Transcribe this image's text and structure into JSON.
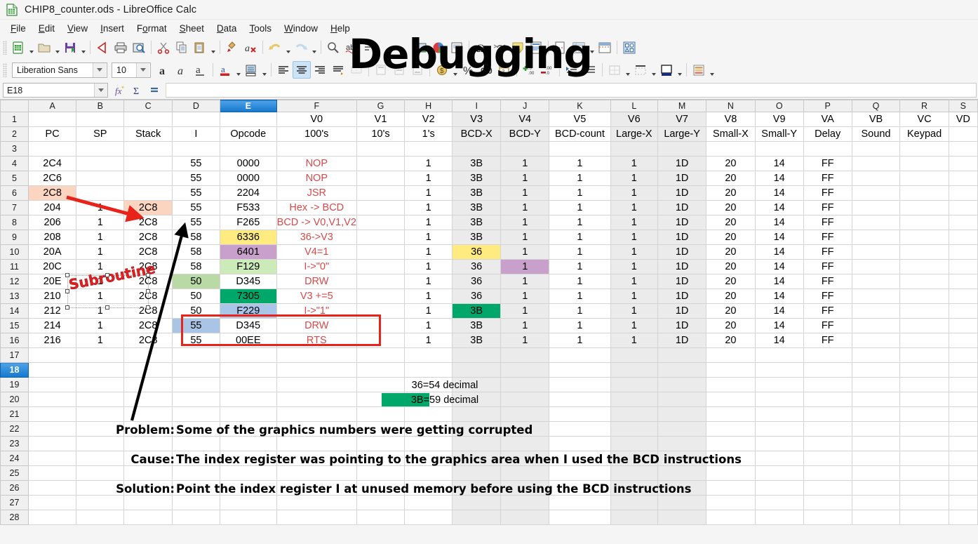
{
  "window": {
    "title": "CHIP8_counter.ods - LibreOffice Calc",
    "app_icon": "calc-document-icon"
  },
  "menubar": {
    "items": [
      {
        "label": "File",
        "accel": "F"
      },
      {
        "label": "Edit",
        "accel": "E"
      },
      {
        "label": "View",
        "accel": "V"
      },
      {
        "label": "Insert",
        "accel": "I"
      },
      {
        "label": "Format",
        "accel": "o"
      },
      {
        "label": "Sheet",
        "accel": "S"
      },
      {
        "label": "Data",
        "accel": "D"
      },
      {
        "label": "Tools",
        "accel": "T"
      },
      {
        "label": "Window",
        "accel": "W"
      },
      {
        "label": "Help",
        "accel": "H"
      }
    ]
  },
  "toolbar_main": {
    "icons": [
      "new-document-icon",
      "open-file-icon",
      "save-document-icon",
      "export-pdf-icon",
      "print-icon",
      "print-preview-icon",
      "cut-icon",
      "copy-icon",
      "paste-icon",
      "clone-formatting-icon",
      "clear-formatting-icon",
      "undo-icon",
      "redo-icon",
      "insert-image-icon",
      "insert-chart-icon",
      "insert-textbox-icon",
      "special-character-icon",
      "insert-hyperlink-icon",
      "insert-comment-icon",
      "headers-footers-icon",
      "freeze-rows-columns-icon",
      "split-window-icon",
      "show-draw-functions-icon"
    ]
  },
  "toolbar_format": {
    "font_name": "Liberation Sans",
    "font_size": "10",
    "icons": [
      "bold-icon",
      "italic-icon",
      "underline-icon",
      "font-color-icon",
      "background-color-icon",
      "align-left-icon",
      "align-center-icon",
      "align-right-icon",
      "wrap-text-icon",
      "merge-cells-icon",
      "align-top-icon",
      "align-center-vertically-icon",
      "align-bottom-icon",
      "currency-format-icon",
      "percent-format-icon",
      "number-format-icon",
      "date-format-icon",
      "add-decimal-icon",
      "delete-decimal-icon",
      "increase-indent-icon",
      "decrease-indent-icon",
      "borders-icon",
      "border-style-icon",
      "background-color-cell-icon",
      "conditional-formatting-icon"
    ],
    "active_icon": "align-center-icon"
  },
  "formula_bar": {
    "name_box": "E18",
    "function_wizard_icon": "function-wizard-icon",
    "sum_icon": "sum-icon",
    "formula_icon": "formula-icon",
    "input_value": ""
  },
  "overlay": {
    "debug_word": "Debugging",
    "subroutine_word": "Subroutine"
  },
  "sheet": {
    "column_letters": [
      "A",
      "B",
      "C",
      "D",
      "E",
      "F",
      "G",
      "H",
      "I",
      "J",
      "K",
      "L",
      "M",
      "N",
      "O",
      "P",
      "Q",
      "R",
      "S"
    ],
    "selected_column": "E",
    "selected_row": 18,
    "row_numbers": [
      1,
      2,
      3,
      4,
      5,
      6,
      7,
      8,
      9,
      10,
      11,
      12,
      13,
      14,
      15,
      16,
      17,
      18,
      19,
      20,
      21,
      22,
      23,
      24,
      25,
      26,
      27,
      28
    ],
    "shaded_columns": [
      "I",
      "J",
      "L",
      "M"
    ],
    "header_row_1": {
      "F": "V0",
      "G": "V1",
      "H": "V2",
      "I": "V3",
      "J": "V4",
      "K": "V5",
      "L": "V6",
      "M": "V7",
      "N": "V8",
      "O": "V9",
      "P": "VA",
      "Q": "VB",
      "R": "VC",
      "S": "VD"
    },
    "header_row_2": {
      "A": "PC",
      "B": "SP",
      "C": "Stack",
      "D": "I",
      "E": "Opcode",
      "F": "100's",
      "G": "10's",
      "H": "1's",
      "I": "BCD-X",
      "J": "BCD-Y",
      "K": "BCD-count",
      "L": "Large-X",
      "M": "Large-Y",
      "N": "Small-X",
      "O": "Small-Y",
      "P": "Delay",
      "Q": "Sound",
      "R": "Keypad",
      "S": ""
    },
    "rows": [
      {
        "n": 4,
        "A": "2C4",
        "B": "",
        "C": "",
        "D": "55",
        "E": "0000",
        "F": "NOP",
        "G": "",
        "H": "1",
        "I": "3B",
        "J": "1",
        "K": "1",
        "L": "1",
        "M": "1D",
        "N": "20",
        "O": "14",
        "P": "FF",
        "Q": "",
        "R": "",
        "S": ""
      },
      {
        "n": 5,
        "A": "2C6",
        "B": "",
        "C": "",
        "D": "55",
        "E": "0000",
        "F": "NOP",
        "G": "",
        "H": "1",
        "I": "3B",
        "J": "1",
        "K": "1",
        "L": "1",
        "M": "1D",
        "N": "20",
        "O": "14",
        "P": "FF",
        "Q": "",
        "R": "",
        "S": ""
      },
      {
        "n": 6,
        "A": "2C8",
        "B": "",
        "C": "",
        "D": "55",
        "E": "2204",
        "F": "JSR",
        "G": "",
        "H": "1",
        "I": "3B",
        "J": "1",
        "K": "1",
        "L": "1",
        "M": "1D",
        "N": "20",
        "O": "14",
        "P": "FF",
        "Q": "",
        "R": "",
        "S": ""
      },
      {
        "n": 7,
        "A": "204",
        "B": "1",
        "C": "2C8",
        "D": "55",
        "E": "F533",
        "F": "Hex -> BCD",
        "G": "",
        "H": "1",
        "I": "3B",
        "J": "1",
        "K": "1",
        "L": "1",
        "M": "1D",
        "N": "20",
        "O": "14",
        "P": "FF",
        "Q": "",
        "R": "",
        "S": ""
      },
      {
        "n": 8,
        "A": "206",
        "B": "1",
        "C": "2C8",
        "D": "55",
        "E": "F265",
        "F": "BCD -> V0,V1,V2",
        "G": "",
        "H": "1",
        "I": "3B",
        "J": "1",
        "K": "1",
        "L": "1",
        "M": "1D",
        "N": "20",
        "O": "14",
        "P": "FF",
        "Q": "",
        "R": "",
        "S": ""
      },
      {
        "n": 9,
        "A": "208",
        "B": "1",
        "C": "2C8",
        "D": "58",
        "E": "6336",
        "F": "36->V3",
        "G": "",
        "H": "1",
        "I": "3B",
        "J": "1",
        "K": "1",
        "L": "1",
        "M": "1D",
        "N": "20",
        "O": "14",
        "P": "FF",
        "Q": "",
        "R": "",
        "S": ""
      },
      {
        "n": 10,
        "A": "20A",
        "B": "1",
        "C": "2C8",
        "D": "58",
        "E": "6401",
        "F": "V4=1",
        "G": "",
        "H": "1",
        "I": "36",
        "J": "1",
        "K": "1",
        "L": "1",
        "M": "1D",
        "N": "20",
        "O": "14",
        "P": "FF",
        "Q": "",
        "R": "",
        "S": ""
      },
      {
        "n": 11,
        "A": "20C",
        "B": "1",
        "C": "2C8",
        "D": "58",
        "E": "F129",
        "F": "I->\"0\"",
        "G": "",
        "H": "1",
        "I": "36",
        "J": "1",
        "K": "1",
        "L": "1",
        "M": "1D",
        "N": "20",
        "O": "14",
        "P": "FF",
        "Q": "",
        "R": "",
        "S": ""
      },
      {
        "n": 12,
        "A": "20E",
        "B": "1",
        "C": "2C8",
        "D": "50",
        "E": "D345",
        "F": "DRW",
        "G": "",
        "H": "1",
        "I": "36",
        "J": "1",
        "K": "1",
        "L": "1",
        "M": "1D",
        "N": "20",
        "O": "14",
        "P": "FF",
        "Q": "",
        "R": "",
        "S": ""
      },
      {
        "n": 13,
        "A": "210",
        "B": "1",
        "C": "2C8",
        "D": "50",
        "E": "7305",
        "F": "V3 +=5",
        "G": "",
        "H": "1",
        "I": "36",
        "J": "1",
        "K": "1",
        "L": "1",
        "M": "1D",
        "N": "20",
        "O": "14",
        "P": "FF",
        "Q": "",
        "R": "",
        "S": ""
      },
      {
        "n": 14,
        "A": "212",
        "B": "1",
        "C": "2C8",
        "D": "50",
        "E": "F229",
        "F": "I->\"1\"",
        "G": "",
        "H": "1",
        "I": "3B",
        "J": "1",
        "K": "1",
        "L": "1",
        "M": "1D",
        "N": "20",
        "O": "14",
        "P": "FF",
        "Q": "",
        "R": "",
        "S": ""
      },
      {
        "n": 15,
        "A": "214",
        "B": "1",
        "C": "2C8",
        "D": "55",
        "E": "D345",
        "F": "DRW",
        "G": "",
        "H": "1",
        "I": "3B",
        "J": "1",
        "K": "1",
        "L": "1",
        "M": "1D",
        "N": "20",
        "O": "14",
        "P": "FF",
        "Q": "",
        "R": "",
        "S": ""
      },
      {
        "n": 16,
        "A": "216",
        "B": "1",
        "C": "2C8",
        "D": "55",
        "E": "00EE",
        "F": "RTS",
        "G": "",
        "H": "1",
        "I": "3B",
        "J": "1",
        "K": "1",
        "L": "1",
        "M": "1D",
        "N": "20",
        "O": "14",
        "P": "FF",
        "Q": "",
        "R": "",
        "S": ""
      }
    ],
    "cell_highlights": [
      {
        "cell": "A6",
        "color": "#fbd5c0"
      },
      {
        "cell": "C7",
        "color": "#fbd5c0"
      },
      {
        "cell": "E9",
        "color": "#ffeb7f"
      },
      {
        "cell": "E10",
        "color": "#c9a0cc"
      },
      {
        "cell": "E11",
        "color": "#ccebb8"
      },
      {
        "cell": "D12",
        "color": "#b9d9a5"
      },
      {
        "cell": "E13",
        "color": "#00a76a"
      },
      {
        "cell": "E14",
        "color": "#a9c5e8"
      },
      {
        "cell": "D15",
        "color": "#aac4e6"
      },
      {
        "cell": "I10",
        "color": "#ffeb7f"
      },
      {
        "cell": "J11",
        "color": "#c9a0cc"
      },
      {
        "cell": "I14",
        "color": "#00a76a"
      }
    ],
    "legend": [
      {
        "row": 19,
        "text": "36=54 decimal",
        "swatch": ""
      },
      {
        "row": 20,
        "text": "3B=59 decimal",
        "swatch": "#00a76a"
      }
    ],
    "notes": [
      {
        "row": 22,
        "label": "Problem:",
        "text": "Some of the graphics numbers were getting corrupted"
      },
      {
        "row": 24,
        "label": "Cause:",
        "text": "The index register was pointing to the graphics area when I used the BCD instructions"
      },
      {
        "row": 26,
        "label": "Solution:",
        "text": "Point the index register I at unused memory before using the BCD instructions"
      }
    ]
  },
  "colors": {
    "accent": "#1678cd",
    "annotation_red": "#e8231a",
    "subroutine_red": "#e02020",
    "formula_text_red": "#d84a4a",
    "highlight_green": "#00a76a",
    "highlight_yellow": "#ffeb7f",
    "highlight_purple": "#c9a0cc",
    "highlight_orange": "#fbd5c0",
    "shaded_column": "#ebebeb"
  }
}
